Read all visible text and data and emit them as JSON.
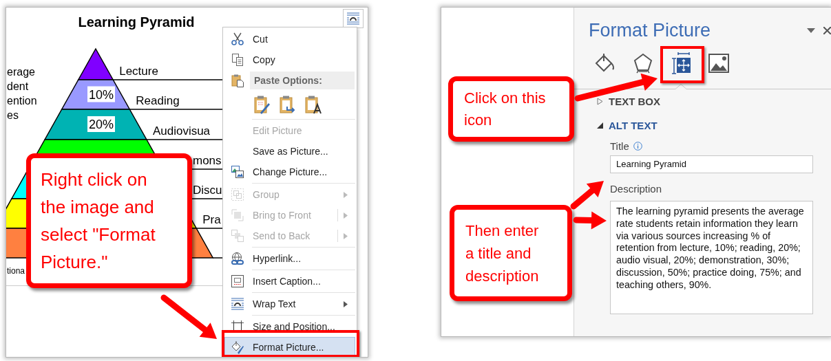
{
  "left_screen": {
    "pyramid": {
      "title": "Learning Pyramid",
      "side_caption_lines": [
        "erage",
        "dent",
        "ention",
        "es"
      ],
      "footer_text": "tiona",
      "levels": [
        {
          "label": "Lecture",
          "color": "#8000ff"
        },
        {
          "label": "Reading",
          "percent": "10%",
          "color": "#9999ff"
        },
        {
          "label": "Audiovisua",
          "percent": "20%",
          "color": "#00b3b3"
        },
        {
          "label": "mons",
          "color": "#00ff00"
        },
        {
          "label": "Discu",
          "color": "#00ffff"
        },
        {
          "label": "Pra",
          "color": "#ffff00"
        },
        {
          "color": "#ff8040"
        }
      ]
    },
    "context_menu": {
      "items": [
        {
          "kind": "item",
          "label": "Cut",
          "disabled": false,
          "has_submenu": false,
          "split": false,
          "selected": false
        },
        {
          "kind": "item",
          "label": "Copy",
          "disabled": false,
          "has_submenu": false,
          "split": false,
          "selected": false
        },
        {
          "kind": "header",
          "label": "Paste Options:"
        },
        {
          "kind": "paste-row"
        },
        {
          "kind": "separator"
        },
        {
          "kind": "item",
          "label": "Edit Picture",
          "disabled": true,
          "has_submenu": false,
          "split": false,
          "selected": false
        },
        {
          "kind": "item",
          "label": "Save as Picture...",
          "disabled": false,
          "has_submenu": false,
          "split": false,
          "selected": false
        },
        {
          "kind": "item",
          "label": "Change Picture...",
          "disabled": false,
          "has_submenu": false,
          "split": false,
          "selected": false
        },
        {
          "kind": "separator"
        },
        {
          "kind": "item",
          "label": "Group",
          "disabled": true,
          "has_submenu": true,
          "split": false,
          "selected": false
        },
        {
          "kind": "item",
          "label": "Bring to Front",
          "disabled": true,
          "has_submenu": true,
          "split": true,
          "selected": false
        },
        {
          "kind": "item",
          "label": "Send to Back",
          "disabled": true,
          "has_submenu": true,
          "split": true,
          "selected": false
        },
        {
          "kind": "separator"
        },
        {
          "kind": "item",
          "label": "Hyperlink...",
          "disabled": false,
          "has_submenu": false,
          "split": false,
          "selected": false
        },
        {
          "kind": "separator"
        },
        {
          "kind": "item",
          "label": "Insert Caption...",
          "disabled": false,
          "has_submenu": false,
          "split": false,
          "selected": false
        },
        {
          "kind": "separator"
        },
        {
          "kind": "item",
          "label": "Wrap Text",
          "disabled": false,
          "has_submenu": true,
          "split": false,
          "selected": false
        },
        {
          "kind": "separator"
        },
        {
          "kind": "item",
          "label": "Size and Position...",
          "disabled": false,
          "has_submenu": false,
          "split": false,
          "selected": false
        },
        {
          "kind": "item",
          "label": "Format Picture...",
          "disabled": false,
          "has_submenu": false,
          "split": false,
          "selected": true
        }
      ]
    },
    "callout": "Right click on the image and select \"Format Picture.\""
  },
  "right_screen": {
    "pane": {
      "title": "Format Picture",
      "tabs": [
        {
          "selected": false
        },
        {
          "selected": false
        },
        {
          "selected": true
        },
        {
          "selected": false
        }
      ],
      "sections": [
        {
          "label": "TEXT BOX",
          "expanded": false
        },
        {
          "label": "ALT TEXT",
          "expanded": true
        }
      ],
      "title_label": "Title",
      "title_value": "Learning Pyramid",
      "description_label": "Description",
      "description_value": "The learning pyramid presents the average rate students retain information they learn via various sources increasing % of retention from lecture, 10%; reading, 20%; audio visual, 20%; demonstration, 30%; discussion, 50%; practice doing, 75%; and teaching others, 90%."
    },
    "callouts": [
      "Click on this icon",
      "Then enter a title and description"
    ]
  }
}
